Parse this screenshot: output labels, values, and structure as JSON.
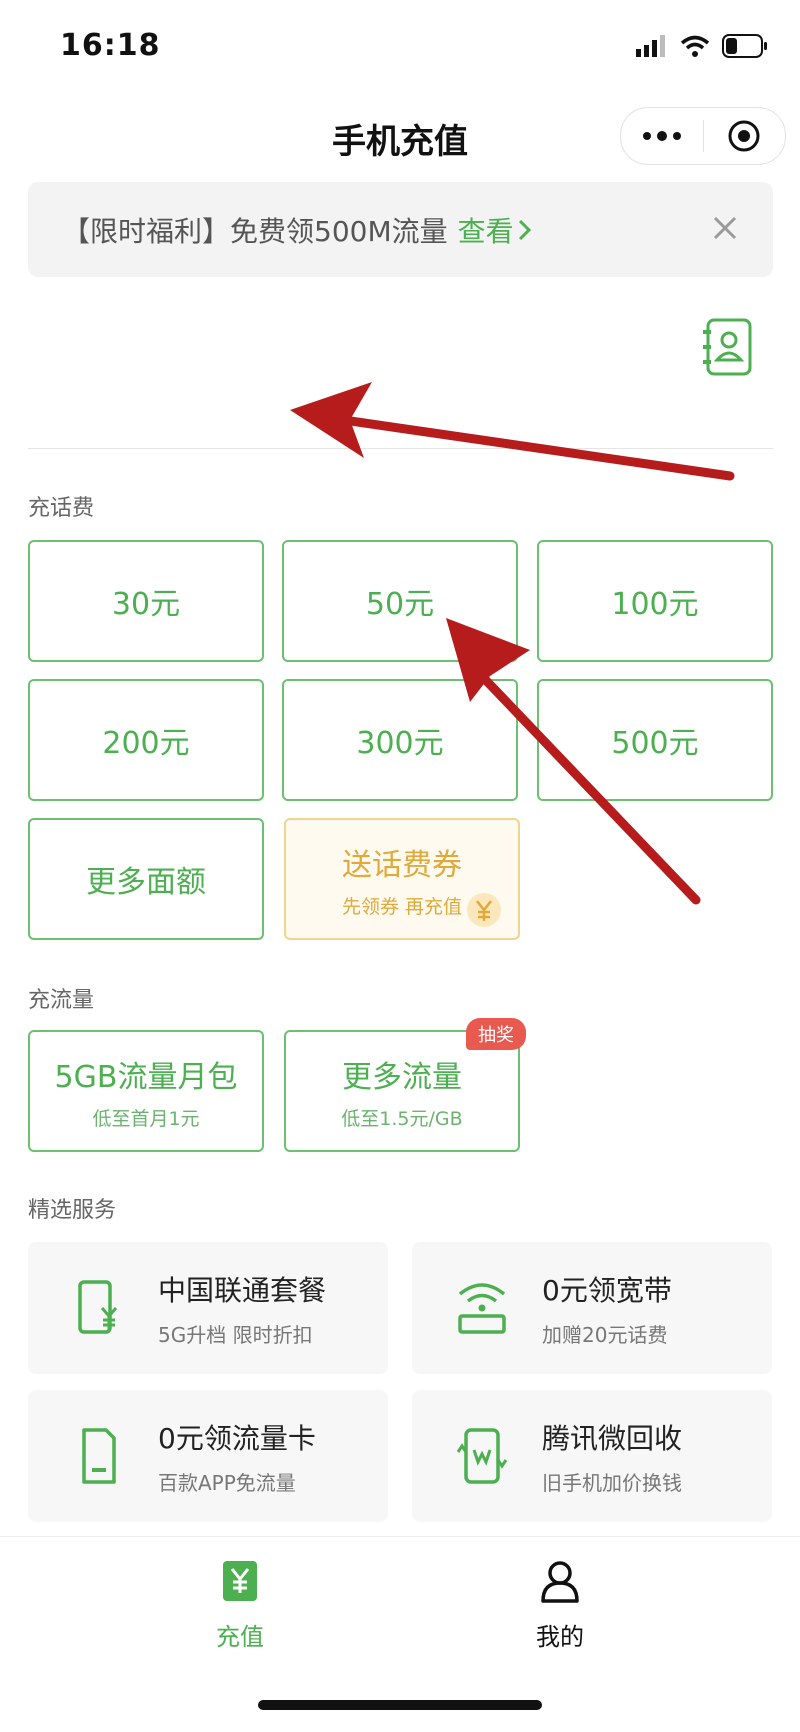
{
  "status_bar": {
    "time": "16:18"
  },
  "nav": {
    "title": "手机充值"
  },
  "banner": {
    "text": "【限时福利】免费领500M流量",
    "link": "查看"
  },
  "sections": {
    "topup": "充话费",
    "data": "充流量",
    "services": "精选服务"
  },
  "topup_options": [
    {
      "label": "30元"
    },
    {
      "label": "50元"
    },
    {
      "label": "100元"
    },
    {
      "label": "200元"
    },
    {
      "label": "300元"
    },
    {
      "label": "500元"
    },
    {
      "label": "更多面额"
    }
  ],
  "coupon": {
    "title": "送话费券",
    "sub": "先领券 再充值"
  },
  "data_options": [
    {
      "title": "5GB流量月包",
      "sub": "低至首月1元"
    },
    {
      "title": "更多流量",
      "sub": "低至1.5元/GB",
      "badge": "抽奖"
    }
  ],
  "services": [
    {
      "title": "中国联通套餐",
      "sub": "5G升档 限时折扣",
      "icon": "phone-yuan-icon"
    },
    {
      "title": "0元领宽带",
      "sub": "加赠20元话费",
      "icon": "wifi-router-icon"
    },
    {
      "title": "0元领流量卡",
      "sub": "百款APP免流量",
      "icon": "sim-card-icon"
    },
    {
      "title": "腾讯微回收",
      "sub": "旧手机加价换钱",
      "icon": "recycle-phone-icon"
    }
  ],
  "tabs": [
    {
      "label": "充值",
      "icon": "yuan-tab-icon",
      "active": true
    },
    {
      "label": "我的",
      "icon": "person-icon",
      "active": false
    }
  ],
  "colors": {
    "accent": "#4caf50",
    "coupon": "#e0a93a",
    "badge": "#e85a4f",
    "annotation_arrow": "#b71c1c"
  }
}
